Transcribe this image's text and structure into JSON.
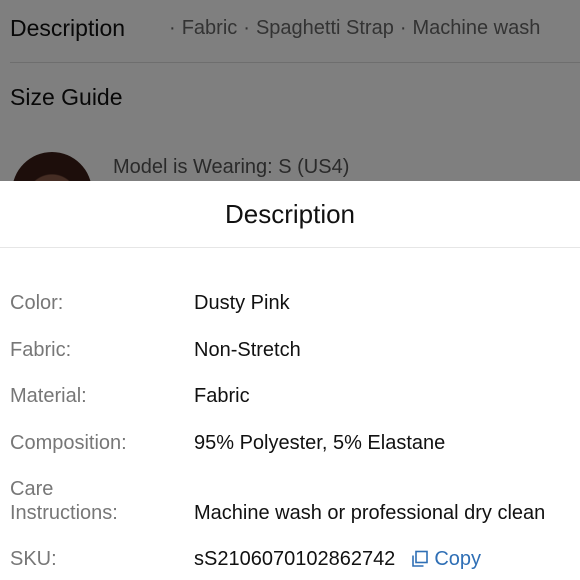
{
  "background": {
    "description_title": "Description",
    "description_values": [
      "Fabric",
      "Spaghetti Strap",
      "Machine wash"
    ],
    "size_guide_title": "Size Guide",
    "model_text": "Model is Wearing: S (US4)"
  },
  "sheet": {
    "title": "Description",
    "rows": [
      {
        "label": "Color:",
        "value": "Dusty Pink"
      },
      {
        "label": "Fabric:",
        "value": "Non-Stretch"
      },
      {
        "label": "Material:",
        "value": "Fabric"
      },
      {
        "label": "Composition:",
        "value": "95% Polyester, 5% Elastane"
      },
      {
        "label": "Care Instructions:",
        "value": "Machine wash or professional dry clean"
      },
      {
        "label": "SKU:",
        "value": "sS2106070102862742"
      }
    ],
    "copy_label": "Copy",
    "copy_icon": "copy-icon",
    "accent_color": "#2f6fb5"
  }
}
